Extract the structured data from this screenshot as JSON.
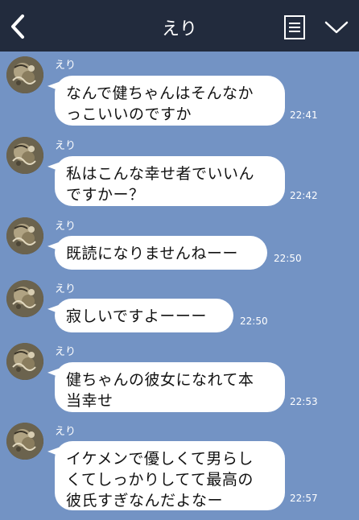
{
  "header": {
    "title": "えり",
    "back_icon": "chevron-left-icon",
    "menu_icon": "menu-list-icon",
    "dropdown_icon": "chevron-down-icon"
  },
  "colors": {
    "background": "#7393c4",
    "header": "#222b3d",
    "bubble": "#ffffff"
  },
  "messages": [
    {
      "sender": "えり",
      "text": "なんで健ちゃんはそんなか\nっこいいのですか",
      "time": "22:41"
    },
    {
      "sender": "えり",
      "text": "私はこんな幸せ者でいいん\nですかー？",
      "time": "22:42"
    },
    {
      "sender": "えり",
      "text": "既読になりませんねーー",
      "time": "22:50"
    },
    {
      "sender": "えり",
      "text": "寂しいですよーーー",
      "time": "22:50"
    },
    {
      "sender": "えり",
      "text": "健ちゃんの彼女になれて本\n当幸せ",
      "time": "22:53"
    },
    {
      "sender": "えり",
      "text": "イケメンで優しくて男らし\nくてしっかりしてて最高の\n彼氏すぎなんだよなー",
      "time": "22:57"
    }
  ]
}
